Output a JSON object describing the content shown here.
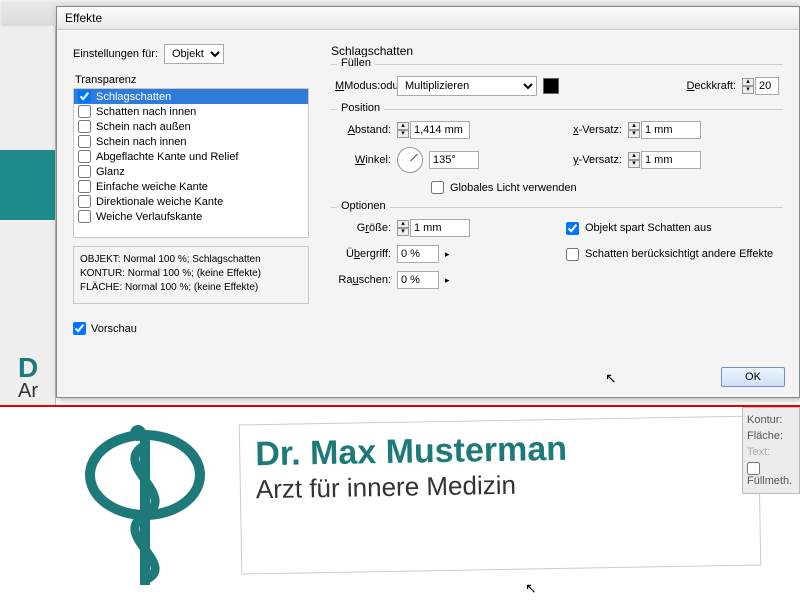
{
  "dialog": {
    "title": "Effekte",
    "settings_for_label": "Einstellungen für:",
    "settings_for_value": "Objekt",
    "transparency_label": "Transparenz",
    "effects": [
      {
        "label": "Schlagschatten",
        "checked": true,
        "selected": true
      },
      {
        "label": "Schatten nach innen",
        "checked": false
      },
      {
        "label": "Schein nach außen",
        "checked": false
      },
      {
        "label": "Schein nach innen",
        "checked": false
      },
      {
        "label": "Abgeflachte Kante und Relief",
        "checked": false
      },
      {
        "label": "Glanz",
        "checked": false
      },
      {
        "label": "Einfache weiche Kante",
        "checked": false
      },
      {
        "label": "Direktionale weiche Kante",
        "checked": false
      },
      {
        "label": "Weiche Verlaufskante",
        "checked": false
      }
    ],
    "summary": [
      "OBJEKT: Normal 100 %; Schlagschatten",
      "KONTUR: Normal 100 %; (keine Effekte)",
      "FLÄCHE: Normal 100 %; (keine Effekte)"
    ],
    "preview_label": "Vorschau",
    "preview_checked": true,
    "panel_title": "Schlagschatten",
    "fill": {
      "group": "Füllen",
      "mode_label": "Modus:",
      "mode_value": "Multiplizieren",
      "opacity_label": "Deckkraft:",
      "opacity_value": "20"
    },
    "position": {
      "group": "Position",
      "distance_label": "Abstand:",
      "distance_value": "1,414 mm",
      "angle_label": "Winkel:",
      "angle_value": "135°",
      "global_light_label": "Globales Licht verwenden",
      "global_light_checked": false,
      "x_offset_label": "x-Versatz:",
      "x_offset_value": "1 mm",
      "y_offset_label": "y-Versatz:",
      "y_offset_value": "1 mm"
    },
    "options": {
      "group": "Optionen",
      "size_label": "Größe:",
      "size_value": "1 mm",
      "spread_label": "Übergriff:",
      "spread_value": "0 %",
      "noise_label": "Rauschen:",
      "noise_value": "0 %",
      "knockout_label": "Objekt spart Schatten aus",
      "knockout_checked": true,
      "honors_label": "Schatten berücksichtigt andere Effekte",
      "honors_checked": false
    },
    "ok": "OK"
  },
  "side_panel": {
    "kontur": "Kontur:",
    "flaeche": "Fläche:",
    "text": "Text:",
    "fuellmeth": "Füllmeth."
  },
  "background": {
    "name_short": "D",
    "sub_short": "Ar",
    "card_name": "Dr. Max Musterman",
    "card_sub": "Arzt für innere Medizin"
  }
}
